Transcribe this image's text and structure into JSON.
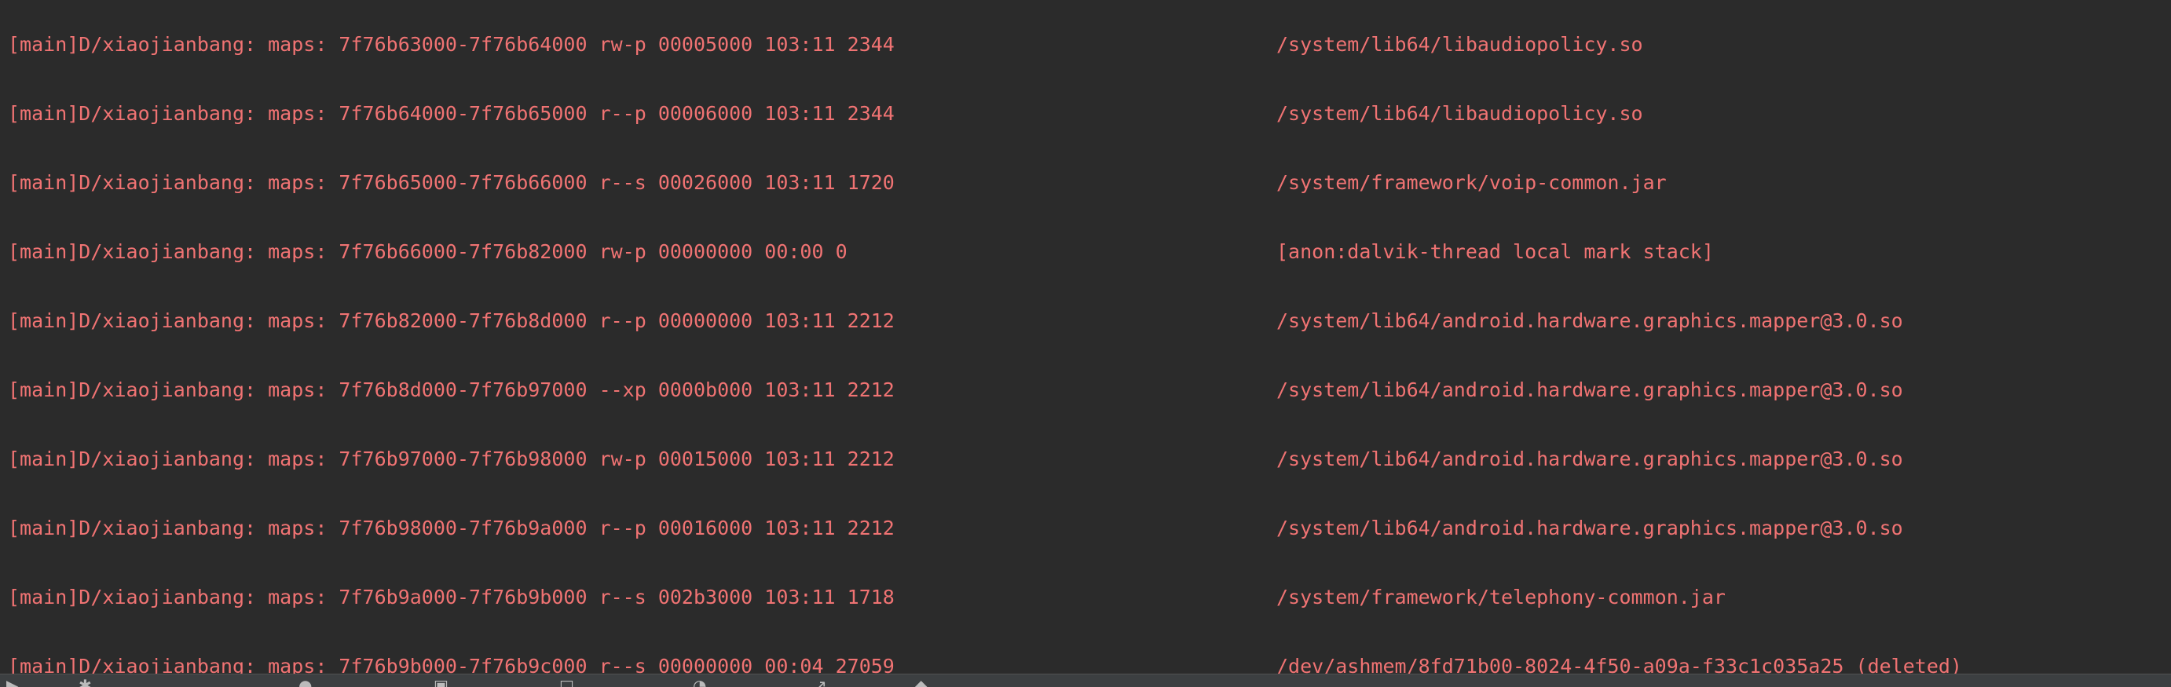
{
  "log": {
    "lines": [
      {
        "message": "[main]D/xiaojianbang: maps: 7f76b63000-7f76b64000 rw-p 00005000 103:11 2344",
        "path": "/system/lib64/libaudiopolicy.so"
      },
      {
        "message": "[main]D/xiaojianbang: maps: 7f76b64000-7f76b65000 r--p 00006000 103:11 2344",
        "path": "/system/lib64/libaudiopolicy.so"
      },
      {
        "message": "[main]D/xiaojianbang: maps: 7f76b65000-7f76b66000 r--s 00026000 103:11 1720",
        "path": "/system/framework/voip-common.jar"
      },
      {
        "message": "[main]D/xiaojianbang: maps: 7f76b66000-7f76b82000 rw-p 00000000 00:00 0",
        "path": "[anon:dalvik-thread local mark stack]"
      },
      {
        "message": "[main]D/xiaojianbang: maps: 7f76b82000-7f76b8d000 r--p 00000000 103:11 2212",
        "path": "/system/lib64/android.hardware.graphics.mapper@3.0.so"
      },
      {
        "message": "[main]D/xiaojianbang: maps: 7f76b8d000-7f76b97000 --xp 0000b000 103:11 2212",
        "path": "/system/lib64/android.hardware.graphics.mapper@3.0.so"
      },
      {
        "message": "[main]D/xiaojianbang: maps: 7f76b97000-7f76b98000 rw-p 00015000 103:11 2212",
        "path": "/system/lib64/android.hardware.graphics.mapper@3.0.so"
      },
      {
        "message": "[main]D/xiaojianbang: maps: 7f76b98000-7f76b9a000 r--p 00016000 103:11 2212",
        "path": "/system/lib64/android.hardware.graphics.mapper@3.0.so"
      },
      {
        "message": "[main]D/xiaojianbang: maps: 7f76b9a000-7f76b9b000 r--s 002b3000 103:11 1718",
        "path": "/system/framework/telephony-common.jar"
      },
      {
        "message": "[main]D/xiaojianbang: maps: 7f76b9b000-7f76b9c000 r--s 00000000 00:04 27059",
        "path": "/dev/ashmem/8fd71b00-8024-4f50-a09a-f33c1c035a25 (deleted)"
      }
    ]
  },
  "colors": {
    "background": "#2b2b2b",
    "log_text": "#f07373",
    "statusbar": "#3c3f41"
  }
}
